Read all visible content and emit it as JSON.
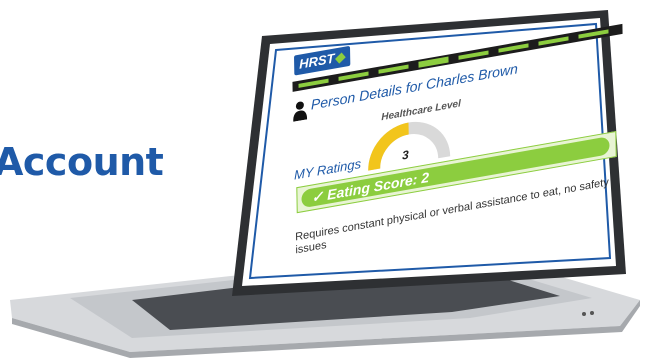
{
  "page": {
    "side_title": "Account"
  },
  "app": {
    "logo_text": "HRST",
    "person_title": "Person Details for Charles Brown",
    "level_label": "Healthcare Level",
    "gauge": {
      "value": 3,
      "max": 6,
      "display": "3"
    },
    "ratings_label": "MY Ratings",
    "score": {
      "check": "✓",
      "label": "Eating Score: 2"
    },
    "description": "Requires constant physical or verbal assistance to eat, no safety issues"
  },
  "colors": {
    "brand_blue": "#1f5aa8",
    "accent_green": "#8ccd3f",
    "gauge_yellow": "#f2c51c",
    "gauge_gray": "#d9d9d9"
  }
}
